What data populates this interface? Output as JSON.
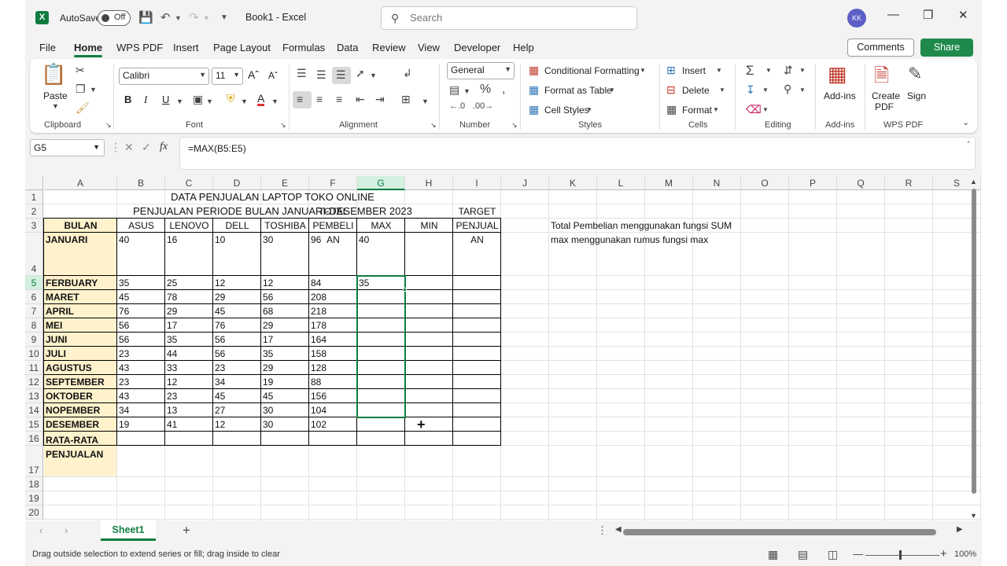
{
  "titlebar": {
    "autosave_label": "AutoSave",
    "autosave_state": "Off",
    "doc_title": "Book1  -  Excel",
    "search_placeholder": "Search",
    "avatar_initials": "KK"
  },
  "menu": {
    "items": [
      "File",
      "Home",
      "WPS PDF",
      "Insert",
      "Page Layout",
      "Formulas",
      "Data",
      "Review",
      "View",
      "Developer",
      "Help"
    ],
    "active": "Home",
    "comments_label": "Comments",
    "share_label": "Share"
  },
  "ribbon": {
    "clipboard": {
      "paste": "Paste",
      "label": "Clipboard"
    },
    "font": {
      "name": "Calibri",
      "size": "11",
      "label": "Font"
    },
    "alignment": {
      "label": "Alignment"
    },
    "number": {
      "format": "General",
      "label": "Number"
    },
    "styles": {
      "conditional": "Conditional Formatting",
      "format_table": "Format as Table",
      "cell_styles": "Cell Styles",
      "label": "Styles"
    },
    "cells": {
      "insert": "Insert",
      "delete": "Delete",
      "format": "Format",
      "label": "Cells"
    },
    "editing": {
      "label": "Editing"
    },
    "addins": {
      "button": "Add-ins",
      "label": "Add-ins"
    },
    "wps": {
      "create": "Create PDF",
      "sign": "Sign",
      "label": "WPS PDF"
    }
  },
  "formula_bar": {
    "name_box": "G5",
    "formula": "=MAX(B5:E5)"
  },
  "grid": {
    "columns": [
      "A",
      "B",
      "C",
      "D",
      "E",
      "F",
      "G",
      "H",
      "I",
      "J",
      "K",
      "L",
      "M",
      "N",
      "O",
      "P",
      "Q",
      "R",
      "S"
    ],
    "rows": [
      "1",
      "2",
      "3",
      "4",
      "5",
      "6",
      "7",
      "8",
      "9",
      "10",
      "11",
      "12",
      "13",
      "14",
      "15",
      "16",
      "17",
      "18",
      "19",
      "20"
    ],
    "selected_column": "G",
    "selected_row": "5",
    "title1": "DATA PENJUALAN LAPTOP TOKO ONLINE",
    "title2": "PENJUALAN PERIODE BULAN JANUARI-DESEMBER 2023",
    "headers": [
      "BULAN",
      "ASUS",
      "LENOVO",
      "DELL",
      "TOSHIBA",
      "TOTAL PEMBELI AN",
      "MAX",
      "MIN",
      "TARGET PENJUAL AN"
    ],
    "data": [
      [
        "JANUARI",
        "40",
        "16",
        "10",
        "30",
        "96",
        "40"
      ],
      [
        "FERBUARY",
        "35",
        "25",
        "12",
        "12",
        "84",
        "35"
      ],
      [
        "MARET",
        "45",
        "78",
        "29",
        "56",
        "208",
        ""
      ],
      [
        "APRIL",
        "76",
        "29",
        "45",
        "68",
        "218",
        ""
      ],
      [
        "MEI",
        "56",
        "17",
        "76",
        "29",
        "178",
        ""
      ],
      [
        "JUNI",
        "56",
        "35",
        "56",
        "17",
        "164",
        ""
      ],
      [
        "JULI",
        "23",
        "44",
        "56",
        "35",
        "158",
        ""
      ],
      [
        "AGUSTUS",
        "43",
        "33",
        "23",
        "29",
        "128",
        ""
      ],
      [
        "SEPTEMBER",
        "23",
        "12",
        "34",
        "19",
        "88",
        ""
      ],
      [
        "OKTOBER",
        "43",
        "23",
        "45",
        "45",
        "156",
        ""
      ],
      [
        "NOPEMBER",
        "34",
        "13",
        "27",
        "30",
        "104",
        ""
      ],
      [
        "DESEMBER",
        "19",
        "41",
        "12",
        "30",
        "102",
        ""
      ]
    ],
    "avg_label": "RATA-RATA PENJUALAN",
    "note1": "Total Pembelian menggunakan fungsi SUM",
    "note2": "max menggunakan rumus fungsi max"
  },
  "sheet_tabs": {
    "active": "Sheet1"
  },
  "status": {
    "message": "Drag outside selection to extend series or fill; drag inside to clear",
    "zoom": "100%"
  },
  "colors": {
    "accent": "#107c41",
    "month_fill": "#fff2cc",
    "header_fill": "#fff2cc"
  }
}
